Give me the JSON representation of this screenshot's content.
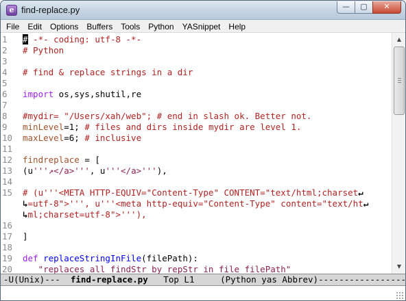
{
  "window": {
    "title": "find-replace.py",
    "app_icon": "emacs-gnu-icon",
    "buttons": {
      "minimize": "—",
      "maximize": "▢",
      "close": "✕"
    }
  },
  "menu": [
    "File",
    "Edit",
    "Options",
    "Buffers",
    "Tools",
    "Python",
    "YASnippet",
    "Help"
  ],
  "editor": {
    "lines": [
      {
        "n": "1",
        "parts": [
          [
            "cursor",
            "#"
          ],
          [
            "comment",
            " -*- coding: utf-8 -*-"
          ]
        ]
      },
      {
        "n": "2",
        "parts": [
          [
            "comment",
            "# Python"
          ]
        ]
      },
      {
        "n": "3",
        "parts": []
      },
      {
        "n": "4",
        "parts": [
          [
            "comment",
            "# find & replace strings in a dir"
          ]
        ]
      },
      {
        "n": "5",
        "parts": []
      },
      {
        "n": "6",
        "parts": [
          [
            "keyword",
            "import"
          ],
          [
            "plain",
            " os,sys,shutil,re"
          ]
        ]
      },
      {
        "n": "7",
        "parts": []
      },
      {
        "n": "8",
        "parts": [
          [
            "comment",
            "#mydir= \"/Users/xah/web\"; # end in slash ok. Better not."
          ]
        ]
      },
      {
        "n": "9",
        "parts": [
          [
            "var",
            "minLevel"
          ],
          [
            "plain",
            "=1; "
          ],
          [
            "comment",
            "# files and dirs inside mydir are level 1."
          ]
        ]
      },
      {
        "n": "10",
        "parts": [
          [
            "var",
            "maxLevel"
          ],
          [
            "plain",
            "=6; "
          ],
          [
            "comment",
            "# inclusive"
          ]
        ]
      },
      {
        "n": "11",
        "parts": []
      },
      {
        "n": "12",
        "parts": [
          [
            "var",
            "findreplace"
          ],
          [
            "plain",
            " = ["
          ]
        ]
      },
      {
        "n": "13",
        "parts": [
          [
            "plain",
            "(u"
          ],
          [
            "string",
            "'''↗</a>'''"
          ],
          [
            "plain",
            ", u"
          ],
          [
            "string",
            "'''</a>'''"
          ],
          [
            "plain",
            "),"
          ]
        ]
      },
      {
        "n": "14",
        "parts": []
      },
      {
        "n": "15",
        "parts": [
          [
            "comment",
            "# (u'''<META HTTP-EQUIV=\"Content-Type\" CONTENT=\"text/html;charset"
          ],
          [
            "wrap",
            "↵"
          ]
        ]
      },
      {
        "n": "",
        "parts": [
          [
            "wrap",
            "↳"
          ],
          [
            "comment",
            "=utf-8\">''', u'''<meta http-equiv=\"Content-Type\" content=\"text/ht"
          ],
          [
            "wrap",
            "↵"
          ]
        ]
      },
      {
        "n": "",
        "parts": [
          [
            "wrap",
            "↳"
          ],
          [
            "comment",
            "ml;charset=utf-8\">'''),"
          ]
        ]
      },
      {
        "n": "16",
        "parts": []
      },
      {
        "n": "17",
        "parts": [
          [
            "plain",
            "]"
          ]
        ]
      },
      {
        "n": "18",
        "parts": []
      },
      {
        "n": "19",
        "parts": [
          [
            "keyword",
            "def"
          ],
          [
            "plain",
            " "
          ],
          [
            "func",
            "replaceStringInFile"
          ],
          [
            "plain",
            "(filePath):"
          ]
        ]
      },
      {
        "n": "20",
        "parts": [
          [
            "string",
            "   \"replaces all findStr by repStr in file filePath\""
          ]
        ]
      }
    ]
  },
  "modeline": {
    "left": "-U(Unix)---  ",
    "buffer": "find-replace.py",
    "position": "   Top L1     ",
    "modes": "(Python yas Abbrev)",
    "fill": "-----------------"
  },
  "scrollbar": {
    "up": "▲",
    "down": "▼"
  },
  "colors": {
    "comment": "#b22222",
    "keyword": "#a020f0",
    "string": "#8b2252",
    "variable": "#a0522d",
    "function": "#0000ff"
  }
}
